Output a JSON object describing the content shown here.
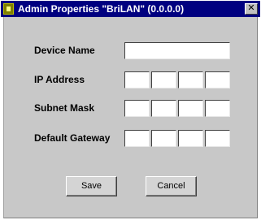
{
  "window": {
    "title": "Admin Properties \"BriLAN\" (0.0.0.0)",
    "close_symbol": "✕",
    "app_icon": "app-icon",
    "title_bar_color": "#000080"
  },
  "form": {
    "device_name": {
      "label": "Device Name",
      "value": ""
    },
    "ip_address": {
      "label": "IP Address",
      "octets": [
        "",
        "",
        "",
        ""
      ]
    },
    "subnet_mask": {
      "label": "Subnet Mask",
      "octets": [
        "",
        "",
        "",
        ""
      ]
    },
    "default_gateway": {
      "label": "Default Gateway",
      "octets": [
        "",
        "",
        "",
        ""
      ]
    }
  },
  "buttons": {
    "save_label": "Save",
    "cancel_label": "Cancel"
  }
}
